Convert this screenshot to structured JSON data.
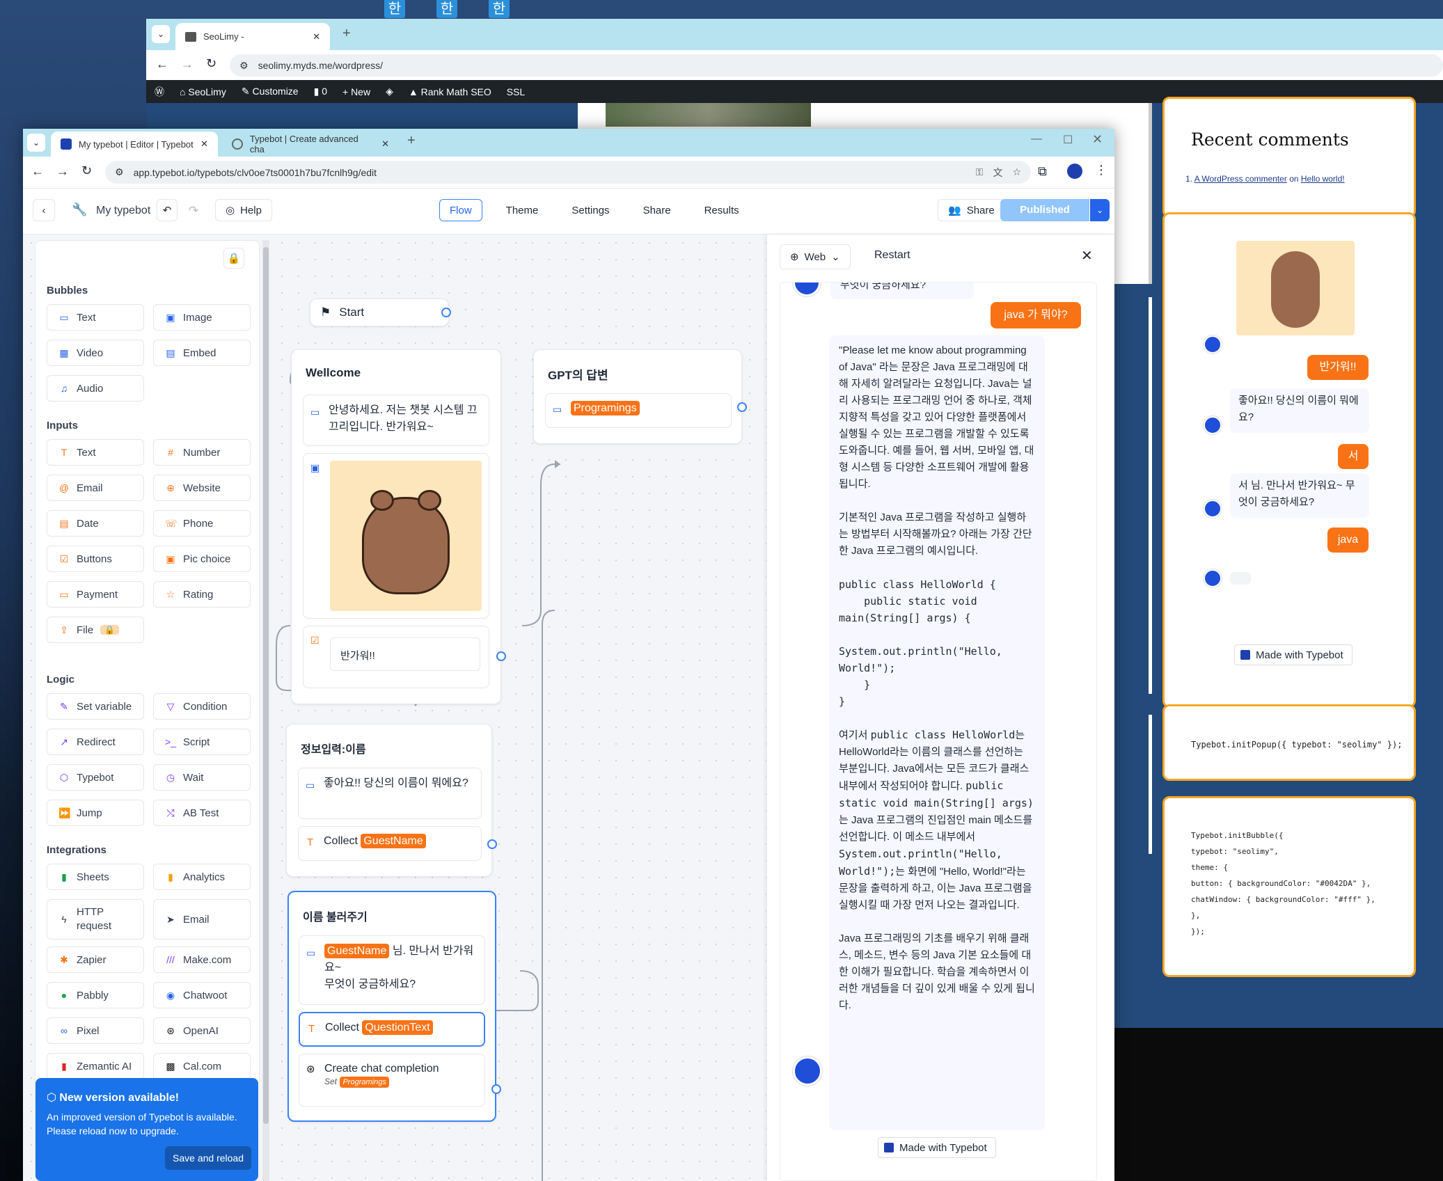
{
  "taskbar": {
    "icons": [
      "한",
      "한",
      "한"
    ]
  },
  "back_browser": {
    "tab_title": "SeoLimy -",
    "url": "seolimy.myds.me/wordpress/",
    "wp_bar": {
      "site": "SeoLimy",
      "customize": "Customize",
      "comments": "0",
      "new": "New",
      "rankmath": "Rank Math SEO",
      "ssl": "SSL"
    },
    "recent_comments": {
      "title": "Recent comments",
      "num": "1.",
      "author": "A WordPress commenter",
      "on": "on",
      "post": "Hello world!"
    },
    "widget_chat": {
      "user1": "반가워!!",
      "bot1": "좋아요!! 당신의 이름이 뭐에요?",
      "user2": "서",
      "bot2": "서 님. 만나서 반가워요~ 무엇이 궁금하세요?",
      "user3": "java",
      "made_with": "Made with Typebot"
    },
    "code_popup": "Typebot.initPopup({ typebot: \"seolimy\" });",
    "code_bubble": [
      "Typebot.initBubble({",
      "typebot: \"seolimy\",",
      "theme: {",
      "button: { backgroundColor: \"#0042DA\" },",
      "chatWindow: { backgroundColor: \"#fff\" },",
      "},",
      "});"
    ]
  },
  "front_browser": {
    "tab1_title": "My typebot | Editor | Typebot",
    "tab2_title": "Typebot | Create advanced cha",
    "url": "app.typebot.io/typebots/clv0oe7ts0001h7bu7fcnlh9g/edit"
  },
  "editor": {
    "name": "My typebot",
    "help": "Help",
    "nav": [
      "Flow",
      "Theme",
      "Settings",
      "Share",
      "Results"
    ],
    "share": "Share",
    "published": "Published"
  },
  "sidebar": {
    "bubbles_title": "Bubbles",
    "bubbles": [
      "Text",
      "Image",
      "Video",
      "Embed",
      "Audio"
    ],
    "inputs_title": "Inputs",
    "inputs": [
      "Text",
      "Number",
      "Email",
      "Website",
      "Date",
      "Phone",
      "Buttons",
      "Pic choice",
      "Payment",
      "Rating",
      "File"
    ],
    "logic_title": "Logic",
    "logic": [
      "Set variable",
      "Condition",
      "Redirect",
      "Script",
      "Typebot",
      "Wait",
      "Jump",
      "AB Test"
    ],
    "integrations_title": "Integrations",
    "integrations": [
      "Sheets",
      "Analytics",
      "HTTP request",
      "Email",
      "Zapier",
      "Make.com",
      "Pabbly",
      "Chatwoot",
      "Pixel",
      "OpenAI",
      "Zemantic AI",
      "Cal.com"
    ]
  },
  "update_toast": {
    "title": "New version available!",
    "body": "An improved version of Typebot is available. Please reload now to upgrade.",
    "button": "Save and reload"
  },
  "canvas": {
    "start": "Start",
    "wellcome": {
      "title": "Wellcome",
      "text": "안녕하세요. 저는 챗봇 시스템 끄끄리입니다. 반가워요~",
      "input_placeholder": "반가워!!"
    },
    "gpt": {
      "title": "GPT의 답변",
      "var": "Programings"
    },
    "info": {
      "title": "정보입력:이름",
      "text": "좋아요!! 당신의 이름이 뭐에요?",
      "collect": "Collect",
      "var": "GuestName"
    },
    "name": {
      "title": "이름 불러주기",
      "var": "GuestName",
      "text1": "님. 만나서 반가워요~",
      "text2": "무엇이 궁금하세요?",
      "collect": "Collect",
      "var2": "QuestionText",
      "openai": "Create chat completion",
      "set": "Set",
      "set_var": "Programings"
    }
  },
  "preview": {
    "web": "Web",
    "restart": "Restart",
    "partial_top": "무엇이 궁금하세요?",
    "user_msg": "java 가 뭐야?",
    "answer_p1": "\"Please let me know about programming of Java\" 라는 문장은 Java 프로그래밍에 대해 자세히 알려달라는 요청입니다. Java는 널리 사용되는 프로그래밍 언어 중 하나로, 객체 지향적 특성을 갖고 있어 다양한 플랫폼에서 실행될 수 있는 프로그램을 개발할 수 있도록 도와줍니다. 예를 들어, 웹 서버, 모바일 앱, 대형 시스템 등 다양한 소프트웨어 개발에 활용됩니다.",
    "answer_p2": "기본적인 Java 프로그램을 작성하고 실행하는 방법부터 시작해볼까요? 아래는 가장 간단한 Java 프로그램의 예시입니다.",
    "code": [
      "public class HelloWorld {",
      "    public static void",
      "main(String[] args) {",
      "",
      "System.out.println(\"Hello,",
      "World!\");",
      "    }",
      "}"
    ],
    "answer_p3_a": "여기서",
    "answer_p3_code1": "public class HelloWorld",
    "answer_p3_b": "는 HelloWorld라는 이름의 클래스를 선언하는 부분입니다. Java에서는 모든 코드가 클래스 내부에서 작성되어야 합니다.",
    "answer_p3_code2": "public static void main(String[] args)",
    "answer_p3_c": "는 Java 프로그램의 진입점인 main 메소드를 선언합니다. 이 메소드 내부에서",
    "answer_p3_code3": "System.out.println(\"Hello, World!\");",
    "answer_p3_d": "는 화면에 \"Hello, World!\"라는 문장을 출력하게 하고, 이는 Java 프로그램을 실행시킬 때 가장 먼저 나오는 결과입니다.",
    "answer_p4": "Java 프로그래밍의 기초를 배우기 위해 클래스, 메소드, 변수 등의 Java 기본 요소들에 대한 이해가 필요합니다. 학습을 계속하면서 이러한 개념들을 더 깊이 있게 배울 수 있게 됩니다.",
    "made_with": "Made with Typebot"
  },
  "colors": {
    "accent": "#f97316",
    "primary": "#3b82f6",
    "brand": "#0042DA"
  }
}
